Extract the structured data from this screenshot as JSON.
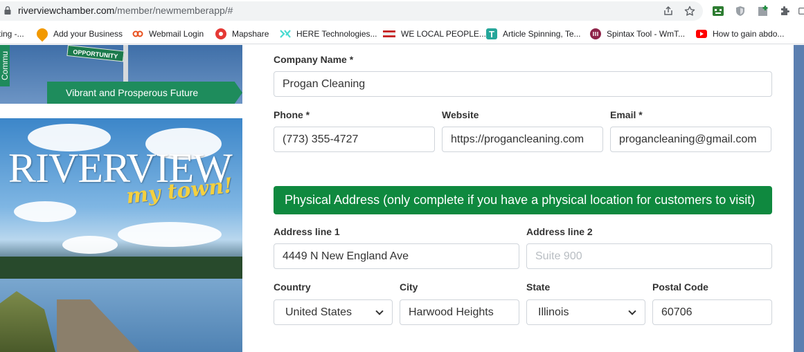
{
  "browser": {
    "url_domain": "riverviewchamber.com",
    "url_path": "/member/newmemberapp/#",
    "bookmarks": [
      {
        "label": "ting -...",
        "icon": "",
        "color": "#ffffff"
      },
      {
        "label": "Add your Business",
        "icon": "pin-icon",
        "color": "#f29900"
      },
      {
        "label": "Webmail Login",
        "icon": "link-icon",
        "color": "#e8501e"
      },
      {
        "label": "Mapshare",
        "icon": "globe-icon",
        "color": "#e53935"
      },
      {
        "label": "HERE Technologies...",
        "icon": "here-icon",
        "color": "#48dad0"
      },
      {
        "label": "WE LOCAL PEOPLE...",
        "icon": "flag-icon",
        "color": "#c62828"
      },
      {
        "label": "Article Spinning, Te...",
        "icon": "t-icon",
        "color": "#26a69a"
      },
      {
        "label": "Spintax Tool - WmT...",
        "icon": "spintax-icon",
        "color": "#8e2449"
      },
      {
        "label": "How to gain abdo...",
        "icon": "youtube-icon",
        "color": "#ff0000"
      }
    ]
  },
  "left": {
    "banner_side_text": "Commu",
    "banner_sign_text": "OPPORTUNITY",
    "banner_ribbon_text": "Vibrant and Prosperous Future",
    "photo_title": "RIVERVIEW",
    "photo_script": "my town!"
  },
  "form": {
    "company": {
      "label": "Company Name *",
      "value": "Progan Cleaning"
    },
    "phone": {
      "label": "Phone *",
      "value": "(773) 355-4727"
    },
    "website": {
      "label": "Website",
      "value": "https://progancleaning.com"
    },
    "email": {
      "label": "Email *",
      "value": "progancleaning@gmail.com"
    },
    "section_title": "Physical Address (only complete if you have a physical location for customers to visit)",
    "address1": {
      "label": "Address line 1",
      "value": "4449 N New England Ave"
    },
    "address2": {
      "label": "Address line 2",
      "value": "",
      "placeholder": "Suite 900"
    },
    "country": {
      "label": "Country",
      "value": "United States"
    },
    "city": {
      "label": "City",
      "value": "Harwood Heights"
    },
    "state": {
      "label": "State",
      "value": "Illinois"
    },
    "postal": {
      "label": "Postal Code",
      "value": "60706"
    }
  },
  "colors": {
    "section_green": "#0f893f",
    "accent_stripe": "#5b7fb0"
  }
}
